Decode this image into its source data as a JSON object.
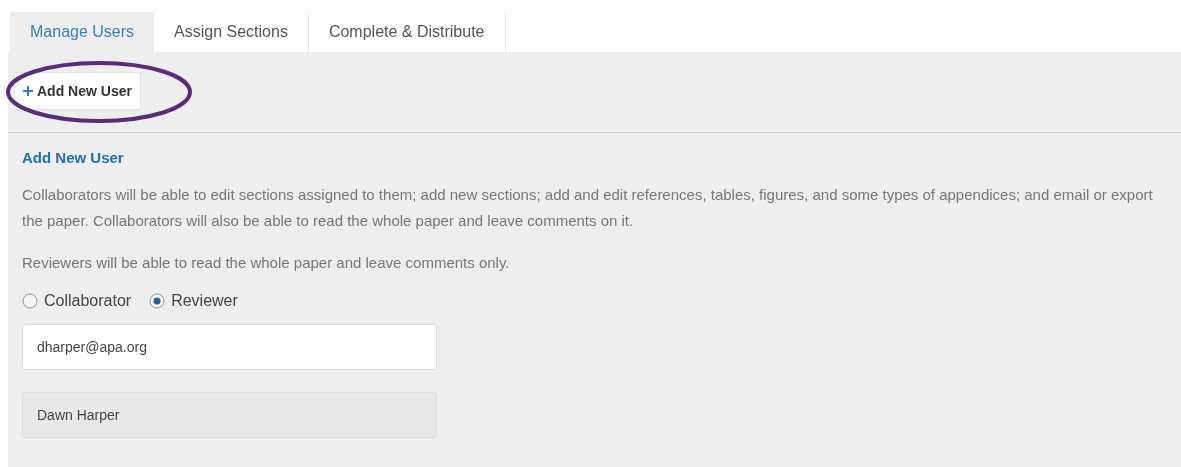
{
  "tabs": [
    {
      "label": "Manage Users",
      "selected": true
    },
    {
      "label": "Assign Sections",
      "selected": false
    },
    {
      "label": "Complete & Distribute",
      "selected": false
    }
  ],
  "add_button": {
    "label": "Add New User",
    "highlighted": true
  },
  "form": {
    "title": "Add New User",
    "paragraphs": [
      "Collaborators will be able to edit sections assigned to them; add new sections; add and edit references, tables, figures, and some types of appendices; and email or export the paper. Collaborators will also be able to read the whole paper and leave comments on it.",
      "Reviewers will be able to read the whole paper and leave comments only."
    ],
    "roles": [
      {
        "label": "Collaborator",
        "selected": false
      },
      {
        "label": "Reviewer",
        "selected": true
      }
    ],
    "fields": [
      {
        "value": "dharper@apa.org",
        "disabled": false
      },
      {
        "value": "Dawn Harper",
        "disabled": true
      }
    ]
  }
}
